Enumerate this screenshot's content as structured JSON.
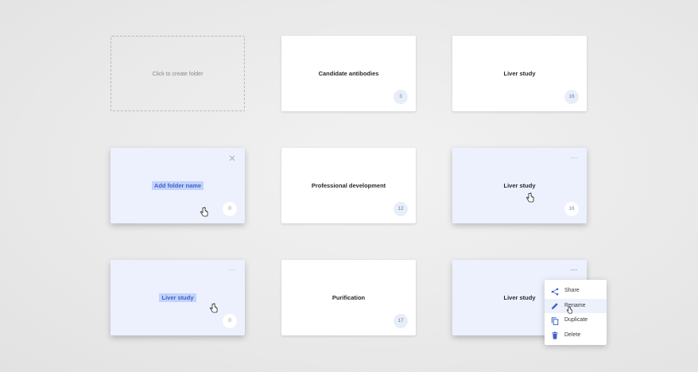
{
  "create_card": {
    "label": "Click to create folder"
  },
  "folders": [
    {
      "title": "Candidate antibodies",
      "count": "3"
    },
    {
      "title": "Liver study",
      "count": "16"
    },
    {
      "title": "Add folder name",
      "count": "0"
    },
    {
      "title": "Professional development",
      "count": "12"
    },
    {
      "title": "Liver study",
      "count": "16"
    },
    {
      "title": "Liver study",
      "count": "0"
    },
    {
      "title": "Purification",
      "count": "17"
    },
    {
      "title": "Liver study"
    }
  ],
  "context_menu": {
    "items": [
      "Share",
      "Rename",
      "Duplicate",
      "Delete"
    ]
  },
  "icons": {
    "more": "…",
    "close": "close-icon",
    "share": "share-icon",
    "rename": "pencil-icon",
    "duplicate": "copy-icon",
    "delete": "trash-icon",
    "cursor": "hand-pointer-icon"
  },
  "colors": {
    "accent": "#3e63c9",
    "selected_card": "#ecf1fd",
    "highlight": "#c3d3fb"
  }
}
